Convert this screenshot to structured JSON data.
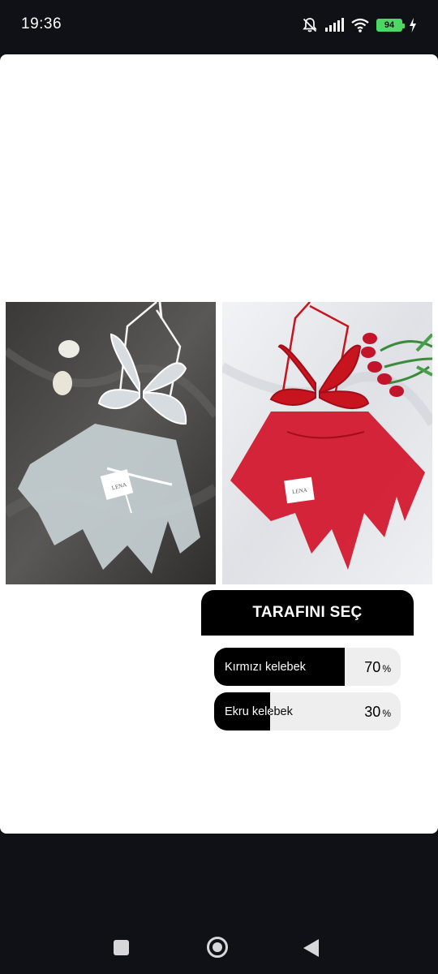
{
  "status_bar": {
    "time": "19:36",
    "battery_level": "94",
    "icons": [
      "bell-off-icon",
      "signal-icon",
      "wifi-icon",
      "battery-icon",
      "charging-icon"
    ]
  },
  "post": {
    "images": [
      {
        "name": "white-butterfly-babydoll",
        "label_text": "LENA"
      },
      {
        "name": "red-butterfly-babydoll",
        "label_text": "LENA"
      }
    ]
  },
  "poll": {
    "title": "TARAFINI SEÇ",
    "options": [
      {
        "label": "Kırmızı kelebek",
        "percent": "70",
        "fraction": 0.7,
        "sign": "%"
      },
      {
        "label": "Ekru kelebek",
        "percent": "30",
        "fraction": 0.3,
        "sign": "%"
      }
    ]
  },
  "colors": {
    "poll_fill": "#000000",
    "poll_track": "#eeeeee",
    "battery": "#4bd964"
  },
  "nav": {
    "icons": [
      "recents-icon",
      "home-icon",
      "back-icon"
    ]
  }
}
